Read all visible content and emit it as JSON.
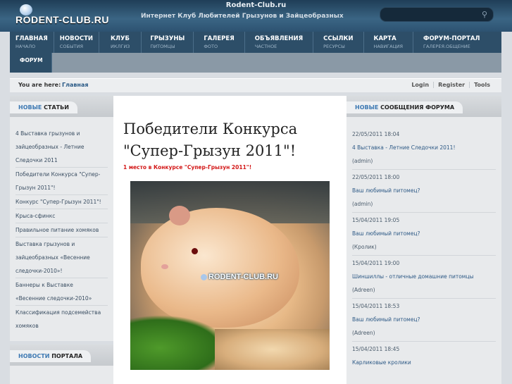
{
  "header": {
    "logo_text": "RODENT-CLUB.RU",
    "site_title": "Rodent-Club.ru",
    "tagline": "Интернет Клуб Любителей Грызунов и Зайцеобразных"
  },
  "nav": [
    {
      "main": "ГЛАВНАЯ",
      "sub": "НАЧАЛО"
    },
    {
      "main": "НОВОСТИ",
      "sub": "СОБЫТИЯ"
    },
    {
      "main": "КЛУБ",
      "sub": "ИКЛГИЗ"
    },
    {
      "main": "ГРЫЗУНЫ",
      "sub": "ПИТОМЦЫ"
    },
    {
      "main": "ГАЛЕРЕЯ",
      "sub": "ФОТО"
    },
    {
      "main": "ОБЪЯВЛЕНИЯ",
      "sub": "ЧАСТНОЕ"
    },
    {
      "main": "ССЫЛКИ",
      "sub": "РЕСУРСЫ"
    },
    {
      "main": "КАРТА",
      "sub": "НАВИГАЦИЯ"
    },
    {
      "main": "ФОРУМ-ПОРТАЛ",
      "sub": "ГАЛЕРЕЯ.ОБЩЕНИЕ"
    }
  ],
  "nav_row2": {
    "forum": "ФОРУМ"
  },
  "breadcrumb": {
    "label": "You are here:",
    "home": "Главная",
    "links": [
      "Login",
      "Register",
      "Tools"
    ]
  },
  "left_col": {
    "tab_hl": "НОВЫЕ",
    "tab_dark": "СТАТЬИ",
    "items": [
      "4 Выставка грызунов и",
      "зайцеобразных - Летние",
      "Следочки 2011",
      "Победители Конкурса \"Супер-",
      "Грызун 2011\"!",
      "Конкурс \"Супер-Грызун 2011\"!",
      "Крыса-сфинкс",
      "Правильное питание хомяков",
      "Выставка грызунов и",
      "зайцеобразных «Весенние",
      "следочки-2010»!",
      "Баннеры к Выставке",
      "«Весенние следочки-2010»",
      "Классификация подсемейства",
      "хомяков"
    ],
    "tab2_hl": "НОВОСТИ",
    "tab2_dark": "ПОРТАЛА"
  },
  "main": {
    "title": "Победители Конкурса \"Супер-Грызун 2011\"!",
    "subtitle": "1 место в Конкурсе \"Супер-Грызун 2011\"!",
    "watermark": "RODENT-CLUB.RU"
  },
  "right_col": {
    "tab_hl": "НОВЫЕ",
    "tab_dark": "СООБЩЕНИЯ ФОРУМА",
    "entries": [
      {
        "date": "22/05/2011 18:04",
        "title": "4 Выставка - Летние Следочки 2011!",
        "author": "(admin)"
      },
      {
        "date": "22/05/2011 18:00",
        "title": "Ваш любимый питомец?",
        "author": "(admin)"
      },
      {
        "date": "15/04/2011 19:05",
        "title": "Ваш любимый питомец?",
        "author": "(Кролик)"
      },
      {
        "date": "15/04/2011 19:00",
        "title": "Шиншиллы - отличные домашние питомцы",
        "author": "(Adreen)"
      },
      {
        "date": "15/04/2011 18:53",
        "title": "Ваш любимый питомец?",
        "author": "(Adreen)"
      },
      {
        "date": "15/04/2011 18:45",
        "title": "Карликовые кролики",
        "author": ""
      }
    ]
  },
  "colors": {
    "header": "#2b4d66",
    "nav": "#2d4e68",
    "link": "#2e5a86",
    "accent_red": "#d31818"
  }
}
